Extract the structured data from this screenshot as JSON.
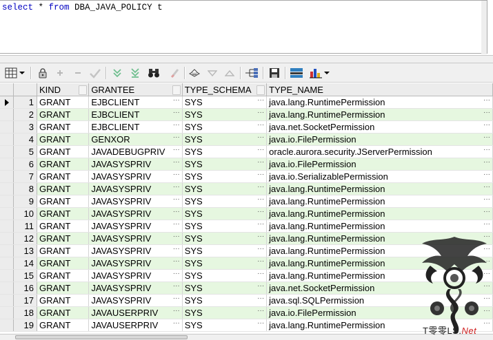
{
  "editor": {
    "sql_kw1": "select",
    "sql_mid1": " * ",
    "sql_kw2": "from",
    "sql_rest": " DBA_JAVA_POLICY t"
  },
  "toolbar": {
    "icons": [
      "grid-view-icon",
      "dropdown-arrow-icon",
      "lock-icon",
      "add-record-icon",
      "delete-record-icon",
      "post-changes-icon",
      "fetch-next-icon",
      "fetch-last-icon",
      "find-icon",
      "clear-icon",
      "print-icon",
      "sort-desc-icon",
      "sort-asc-icon",
      "tree-icon",
      "save-icon",
      "export-icon",
      "chart-icon",
      "chart-dropdown-icon"
    ]
  },
  "grid": {
    "columns": [
      "KIND",
      "GRANTEE",
      "TYPE_SCHEMA",
      "TYPE_NAME"
    ],
    "rows": [
      [
        "1",
        "GRANT",
        "EJBCLIENT",
        "SYS",
        "java.lang.RuntimePermission"
      ],
      [
        "2",
        "GRANT",
        "EJBCLIENT",
        "SYS",
        "java.lang.RuntimePermission"
      ],
      [
        "3",
        "GRANT",
        "EJBCLIENT",
        "SYS",
        "java.net.SocketPermission"
      ],
      [
        "4",
        "GRANT",
        "GENXOR",
        "SYS",
        "java.io.FilePermission"
      ],
      [
        "5",
        "GRANT",
        "JAVADEBUGPRIV",
        "SYS",
        "oracle.aurora.security.JServerPermission"
      ],
      [
        "6",
        "GRANT",
        "JAVASYSPRIV",
        "SYS",
        "java.io.FilePermission"
      ],
      [
        "7",
        "GRANT",
        "JAVASYSPRIV",
        "SYS",
        "java.io.SerializablePermission"
      ],
      [
        "8",
        "GRANT",
        "JAVASYSPRIV",
        "SYS",
        "java.lang.RuntimePermission"
      ],
      [
        "9",
        "GRANT",
        "JAVASYSPRIV",
        "SYS",
        "java.lang.RuntimePermission"
      ],
      [
        "10",
        "GRANT",
        "JAVASYSPRIV",
        "SYS",
        "java.lang.RuntimePermission"
      ],
      [
        "11",
        "GRANT",
        "JAVASYSPRIV",
        "SYS",
        "java.lang.RuntimePermission"
      ],
      [
        "12",
        "GRANT",
        "JAVASYSPRIV",
        "SYS",
        "java.lang.RuntimePermission"
      ],
      [
        "13",
        "GRANT",
        "JAVASYSPRIV",
        "SYS",
        "java.lang.RuntimePermission"
      ],
      [
        "14",
        "GRANT",
        "JAVASYSPRIV",
        "SYS",
        "java.lang.RuntimePermission"
      ],
      [
        "15",
        "GRANT",
        "JAVASYSPRIV",
        "SYS",
        "java.lang.RuntimePermission"
      ],
      [
        "16",
        "GRANT",
        "JAVASYSPRIV",
        "SYS",
        "java.net.SocketPermission"
      ],
      [
        "17",
        "GRANT",
        "JAVASYSPRIV",
        "SYS",
        "java.sql.SQLPermission"
      ],
      [
        "18",
        "GRANT",
        "JAVAUSERPRIV",
        "SYS",
        "java.io.FilePermission"
      ],
      [
        "19",
        "GRANT",
        "JAVAUSERPRIV",
        "SYS",
        "java.lang.RuntimePermission"
      ]
    ],
    "current_row": "1"
  },
  "watermark": {
    "text_main": "T零零LS.",
    "text_accent": "Net"
  },
  "colors": {
    "keyword": "#0000c0",
    "even_row": "#e6f7e0",
    "header_bg": "#ececec"
  }
}
